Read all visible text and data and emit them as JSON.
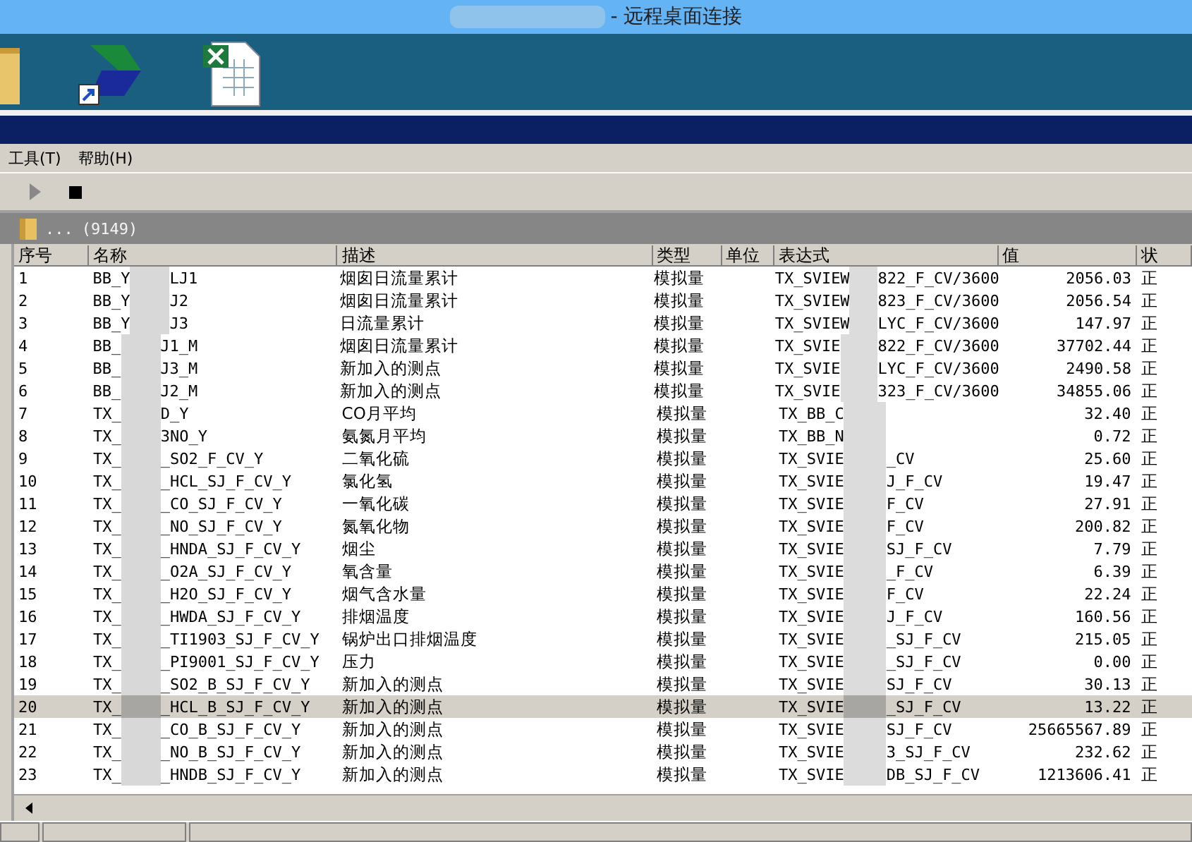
{
  "window": {
    "title": "- 远程桌面连接"
  },
  "menu": [
    "工具(T)",
    "帮助(H)"
  ],
  "path_bar": {
    "path": "...",
    "count": "(9149)"
  },
  "table": {
    "columns": [
      "序号",
      "名称",
      "描述",
      "类型",
      "单位",
      "表达式",
      "值",
      "状"
    ],
    "rows": [
      {
        "index": "1",
        "name_start": "BB_Y",
        "name_end": "LJ1",
        "description": "烟囱日流量累计",
        "type": "模拟量",
        "expr_start": "TX_SVIEW",
        "expr_end": "822_F_CV/3600",
        "value": "2056.03",
        "status": "正",
        "selected": false
      },
      {
        "index": "2",
        "name_start": "BB_Y",
        "name_end": "J2",
        "description": "烟囱日流量累计",
        "type": "模拟量",
        "expr_start": "TX_SVIEW",
        "expr_end": "823_F_CV/3600",
        "value": "2056.54",
        "status": "正",
        "selected": false
      },
      {
        "index": "3",
        "name_start": "BB_Y",
        "name_end": "J3",
        "description": "日流量累计",
        "type": "模拟量",
        "expr_start": "TX_SVIEW",
        "expr_end": "LYC_F_CV/3600",
        "value": "147.97",
        "status": "正",
        "selected": false
      },
      {
        "index": "4",
        "name_start": "BB_",
        "name_end": "J1_M",
        "description": "烟囱日流量累计",
        "type": "模拟量",
        "expr_start": "TX_SVIE",
        "expr_end": "822_F_CV/3600",
        "value": "37702.44",
        "status": "正",
        "selected": false
      },
      {
        "index": "5",
        "name_start": "BB_",
        "name_end": "J3_M",
        "description": "新加入的测点",
        "type": "模拟量",
        "expr_start": "TX_SVIE",
        "expr_end": "LYC_F_CV/3600",
        "value": "2490.58",
        "status": "正",
        "selected": false
      },
      {
        "index": "6",
        "name_start": "BB_",
        "name_end": "J2_M",
        "description": "新加入的测点",
        "type": "模拟量",
        "expr_start": "TX_SVIE",
        "expr_end": "323_F_CV/3600",
        "value": "34855.06",
        "status": "正",
        "selected": false
      },
      {
        "index": "7",
        "name_start": "TX_",
        "name_end": "D_Y",
        "description": "CO月平均",
        "type": "模拟量",
        "expr_start": "TX_BB_C",
        "value": "32.40",
        "status": "正",
        "selected": false
      },
      {
        "index": "8",
        "name_start": "TX_",
        "name_end": "3NO_Y",
        "description": "氨氮月平均",
        "type": "模拟量",
        "expr_start": "TX_BB_N",
        "value": "0.72",
        "status": "正",
        "selected": false
      },
      {
        "index": "9",
        "name_start": "TX_",
        "name_end": "_SO2_F_CV_Y",
        "description": "二氧化硫",
        "type": "模拟量",
        "expr_start": "TX_SVIE",
        "expr_end": "_CV",
        "value": "25.60",
        "status": "正",
        "selected": false
      },
      {
        "index": "10",
        "name_start": "TX_",
        "name_end": "_HCL_SJ_F_CV_Y",
        "description": "氯化氢",
        "type": "模拟量",
        "expr_start": "TX_SVIE",
        "expr_end": "J_F_CV",
        "value": "19.47",
        "status": "正",
        "selected": false
      },
      {
        "index": "11",
        "name_start": "TX_",
        "name_end": "_CO_SJ_F_CV_Y",
        "description": "一氧化碳",
        "type": "模拟量",
        "expr_start": "TX_SVIE",
        "expr_end": "F_CV",
        "value": "27.91",
        "status": "正",
        "selected": false
      },
      {
        "index": "12",
        "name_start": "TX_",
        "name_end": "_NO_SJ_F_CV_Y",
        "description": "氮氧化物",
        "type": "模拟量",
        "expr_start": "TX_SVIE",
        "expr_end": "F_CV",
        "value": "200.82",
        "status": "正",
        "selected": false
      },
      {
        "index": "13",
        "name_start": "TX_",
        "name_end": "_HNDA_SJ_F_CV_Y",
        "description": "烟尘",
        "type": "模拟量",
        "expr_start": "TX_SVIE",
        "expr_end": "SJ_F_CV",
        "value": "7.79",
        "status": "正",
        "selected": false
      },
      {
        "index": "14",
        "name_start": "TX_",
        "name_end": "_O2A_SJ_F_CV_Y",
        "description": "氧含量",
        "type": "模拟量",
        "expr_start": "TX_SVIE",
        "expr_end": "_F_CV",
        "value": "6.39",
        "status": "正",
        "selected": false
      },
      {
        "index": "15",
        "name_start": "TX_",
        "name_end": "_H2O_SJ_F_CV_Y",
        "description": "烟气含水量",
        "type": "模拟量",
        "expr_start": "TX_SVIE",
        "expr_end": "F_CV",
        "value": "22.24",
        "status": "正",
        "selected": false
      },
      {
        "index": "16",
        "name_start": "TX_",
        "name_end": "_HWDA_SJ_F_CV_Y",
        "description": "排烟温度",
        "type": "模拟量",
        "expr_start": "TX_SVIE",
        "expr_end": "J_F_CV",
        "value": "160.56",
        "status": "正",
        "selected": false
      },
      {
        "index": "17",
        "name_start": "TX_",
        "name_end": "_TI1903_SJ_F_CV_Y",
        "description": "锅炉出口排烟温度",
        "type": "模拟量",
        "expr_start": "TX_SVIE",
        "expr_end": "_SJ_F_CV",
        "value": "215.05",
        "status": "正",
        "selected": false
      },
      {
        "index": "18",
        "name_start": "TX_",
        "name_end": "_PI9001_SJ_F_CV_Y",
        "description": "压力",
        "type": "模拟量",
        "expr_start": "TX_SVIE",
        "expr_end": "_SJ_F_CV",
        "value": "0.00",
        "status": "正",
        "selected": false
      },
      {
        "index": "19",
        "name_start": "TX_",
        "name_end": "_SO2_B_SJ_F_CV_Y",
        "description": "新加入的测点",
        "type": "模拟量",
        "expr_start": "TX_SVIE",
        "expr_end": "SJ_F_CV",
        "value": "30.13",
        "status": "正",
        "selected": false
      },
      {
        "index": "20",
        "name_start": "TX_",
        "name_end": "_HCL_B_SJ_F_CV_Y",
        "description": "新加入的测点",
        "type": "模拟量",
        "expr_start": "TX_SVIE",
        "expr_end": "_SJ_F_CV",
        "value": "13.22",
        "status": "正",
        "selected": true
      },
      {
        "index": "21",
        "name_start": "TX_",
        "name_end": "_CO_B_SJ_F_CV_Y",
        "description": "新加入的测点",
        "type": "模拟量",
        "expr_start": "TX_SVIE",
        "expr_end": "SJ_F_CV",
        "value": "25665567.89",
        "status": "正",
        "selected": false
      },
      {
        "index": "22",
        "name_start": "TX_",
        "name_end": "_NO_B_SJ_F_CV_Y",
        "description": "新加入的测点",
        "type": "模拟量",
        "expr_start": "TX_SVIE",
        "expr_end": "3_SJ_F_CV",
        "value": "232.62",
        "status": "正",
        "selected": false
      },
      {
        "index": "23",
        "name_start": "TX_",
        "name_end": "_HNDB_SJ_F_CV_Y",
        "description": "新加入的测点",
        "type": "模拟量",
        "expr_start": "TX_SVIE",
        "expr_end": "DB_SJ_F_CV",
        "value": "1213606.41",
        "status": "正",
        "selected": false
      }
    ]
  }
}
